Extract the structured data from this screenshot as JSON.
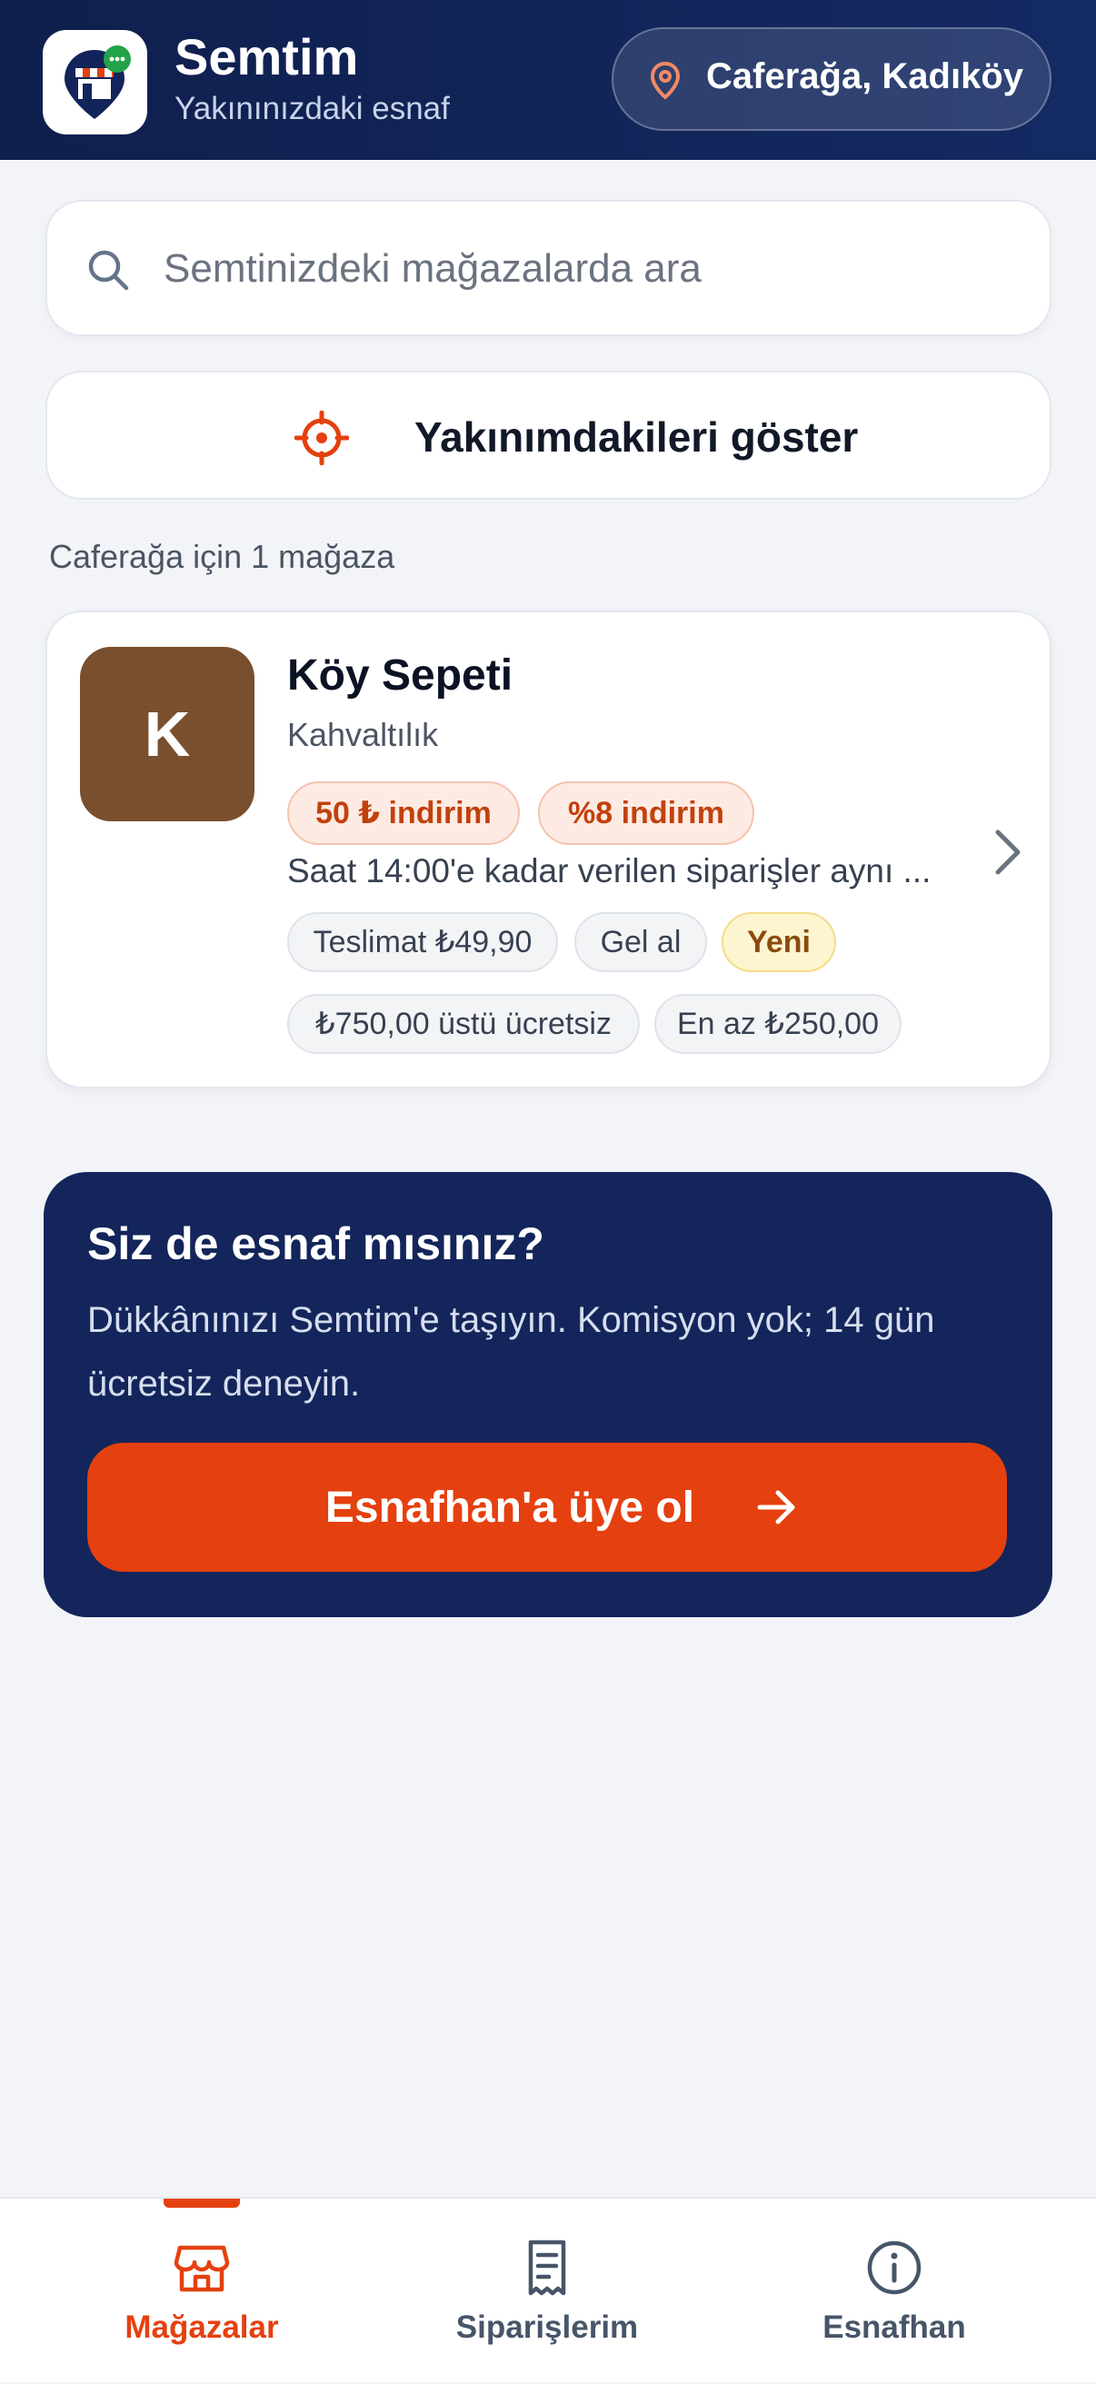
{
  "header": {
    "app_name": "Semtim",
    "tagline": "Yakınınızdaki esnaf",
    "location": "Caferağa, Kadıköy"
  },
  "search": {
    "placeholder": "Semtinizdeki mağazalarda ara"
  },
  "nearby_button": {
    "label": "Yakınımdakileri göster"
  },
  "results_summary": "Caferağa için 1 mağaza",
  "stores": [
    {
      "initial": "K",
      "avatar_color": "#7a4f2d",
      "name": "Köy Sepeti",
      "category": "Kahvaltılık",
      "promos": [
        "50 ₺ indirim",
        "%8 indirim"
      ],
      "description": "Saat 14:00'e kadar verilen siparişler aynı ...",
      "tags": [
        "Teslimat ₺49,90",
        "Gel al",
        "Yeni",
        "₺750,00 üstü ücretsiz",
        "En az ₺250,00"
      ]
    }
  ],
  "merchant_cta": {
    "title": "Siz de esnaf mısınız?",
    "description": "Dükkânınızı Semtim'e taşıyın. Komisyon yok; 14 gün ücretsiz deneyin.",
    "button_label": "Esnafhan'a üye ol"
  },
  "bottom_nav": [
    {
      "label": "Mağazalar",
      "icon": "store-icon",
      "active": true
    },
    {
      "label": "Siparişlerim",
      "icon": "receipt-icon",
      "active": false
    },
    {
      "label": "Esnafhan",
      "icon": "info-icon",
      "active": false
    }
  ],
  "colors": {
    "header_bg": "#0f1f4d",
    "accent": "#e5400f",
    "cta_bg": "#13255a",
    "page_bg": "#f2f4f8"
  }
}
